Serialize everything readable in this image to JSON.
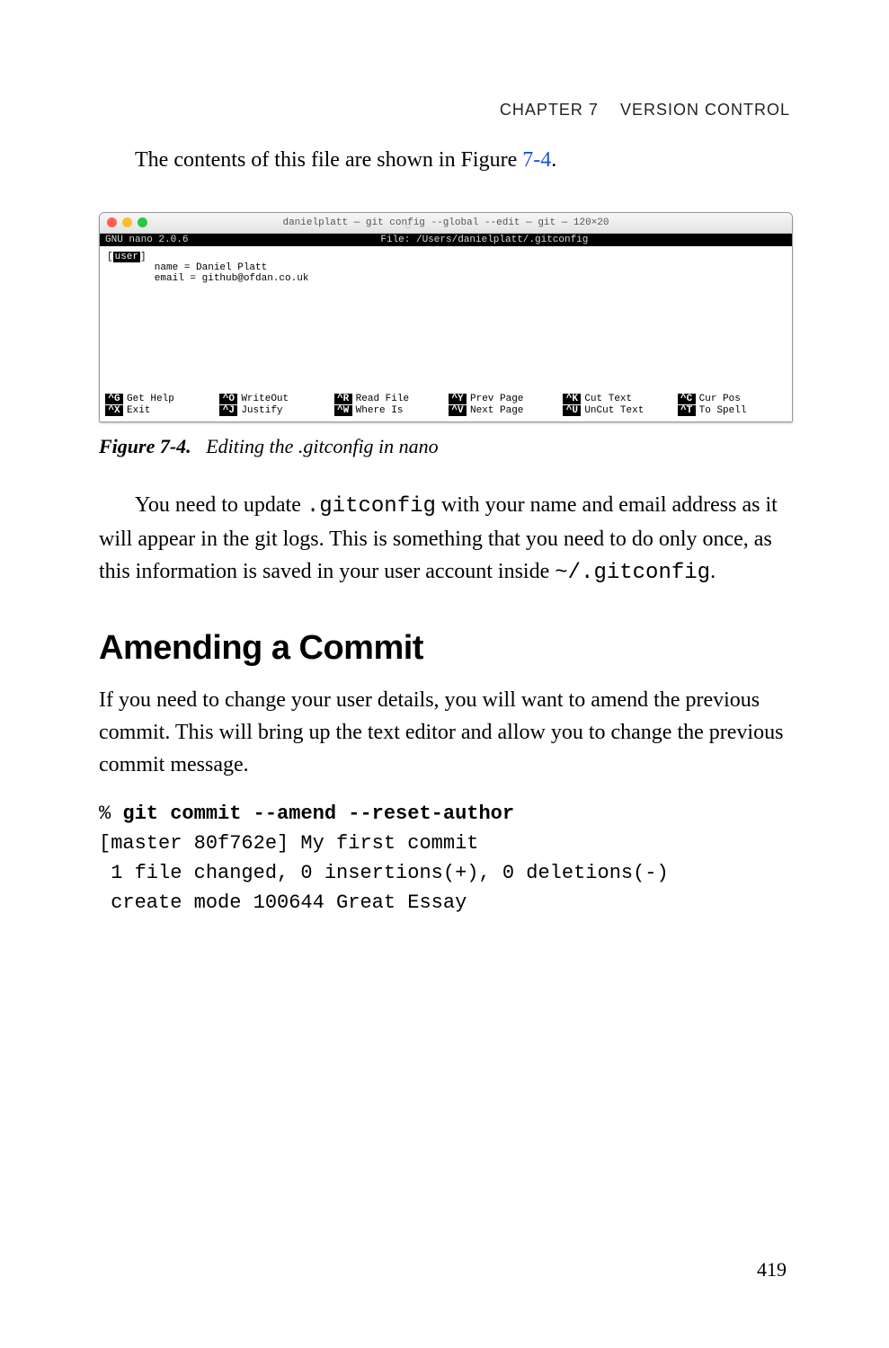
{
  "header": {
    "chapter": "CHAPTER 7",
    "title": "VERSION CONTROL"
  },
  "intro_line_pre": "The contents of this file are shown in Figure ",
  "intro_link": "7-4",
  "intro_line_post": ".",
  "terminal": {
    "window_title": "danielplatt — git config --global --edit — git — 120×20",
    "home_icon": "⌂",
    "nano_version": "GNU nano 2.0.6",
    "file_label": "File: /Users/danielplatt/.gitconfig",
    "lines": [
      {
        "tag": "[",
        "section": "user",
        "rest": "]"
      },
      {
        "plain": "        name = Daniel Platt"
      },
      {
        "plain": "        email = github@ofdan.co.uk"
      }
    ],
    "shortcuts": [
      {
        "key": "^G",
        "label": "Get Help"
      },
      {
        "key": "^O",
        "label": "WriteOut"
      },
      {
        "key": "^R",
        "label": "Read File"
      },
      {
        "key": "^Y",
        "label": "Prev Page"
      },
      {
        "key": "^K",
        "label": "Cut Text"
      },
      {
        "key": "^C",
        "label": "Cur Pos"
      },
      {
        "key": "^X",
        "label": "Exit"
      },
      {
        "key": "^J",
        "label": "Justify"
      },
      {
        "key": "^W",
        "label": "Where Is"
      },
      {
        "key": "^V",
        "label": "Next Page"
      },
      {
        "key": "^U",
        "label": "UnCut Text"
      },
      {
        "key": "^T",
        "label": "To Spell"
      }
    ]
  },
  "figure": {
    "num": "Figure 7-4.",
    "caption": "Editing the .gitconfig in nano"
  },
  "para1_a": "You need to update ",
  "para1_code1": ".gitconfig",
  "para1_b": " with your name and email address as it will appear in the git logs. This is something that you need to do only once, as this information is saved in your user account inside ",
  "para1_code2": "~/.gitconfig",
  "para1_c": ".",
  "section_heading": "Amending a Commit",
  "para2": "If you need to change your user details, you will want to amend the previous commit. This will bring up the text editor and allow you to change the previous commit message.",
  "code": {
    "prompt": "% ",
    "command": "git commit --amend --reset-author",
    "out1": "[master 80f762e] My first commit",
    "out2": " 1 file changed, 0 insertions(+), 0 deletions(-)",
    "out3": " create mode 100644 Great Essay"
  },
  "page_number": "419"
}
